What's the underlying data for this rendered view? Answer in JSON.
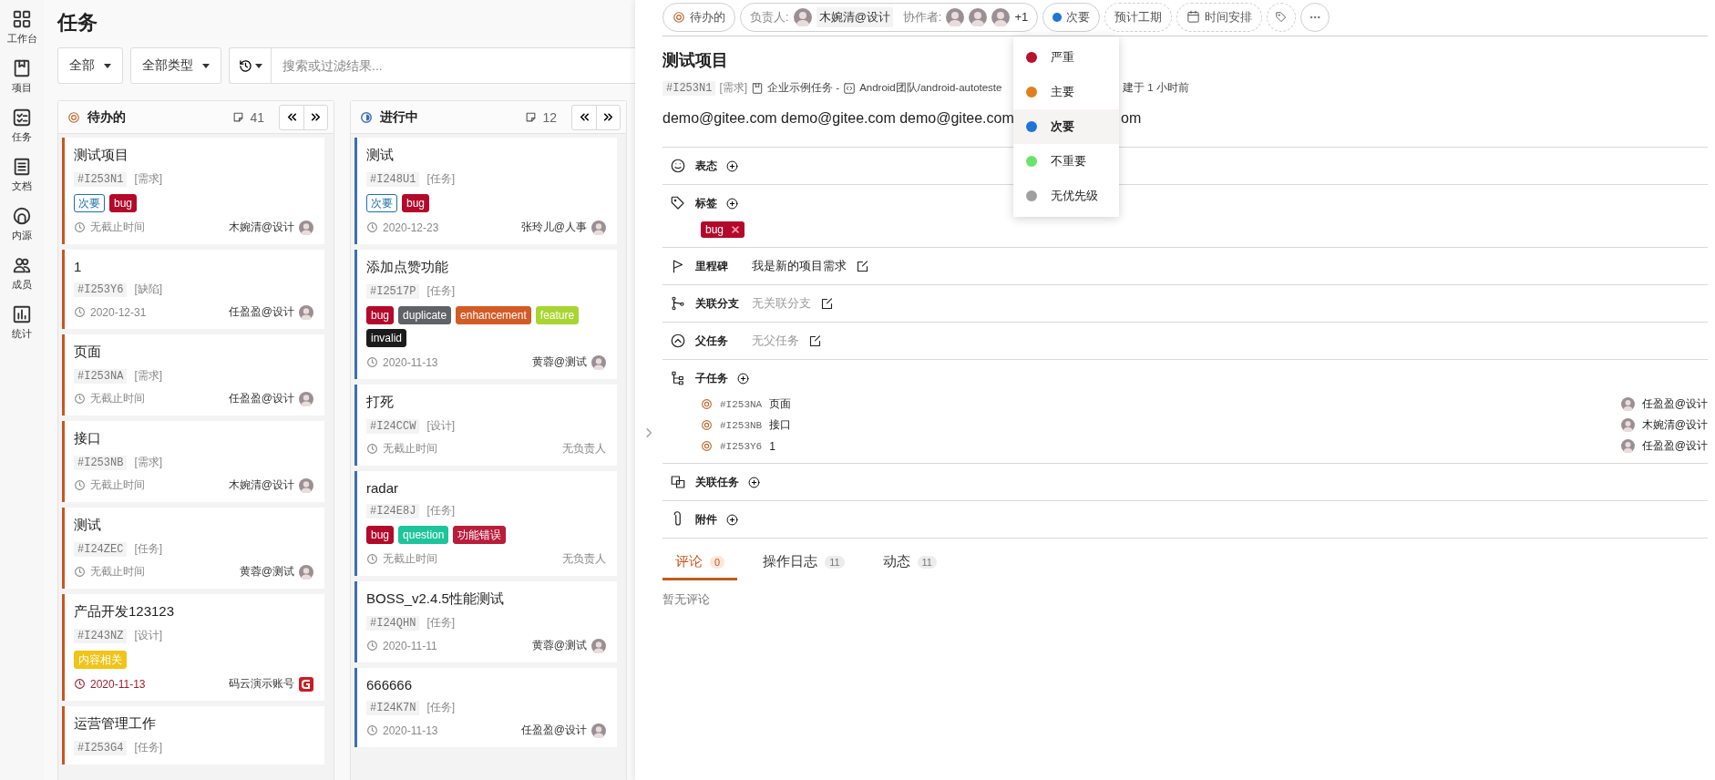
{
  "sidebar": {
    "items": [
      {
        "label": "工作台",
        "kind": "dashboard"
      },
      {
        "label": "项目",
        "kind": "project"
      },
      {
        "label": "任务",
        "kind": "task"
      },
      {
        "label": "文档",
        "kind": "doc"
      },
      {
        "label": "内源",
        "kind": "source"
      },
      {
        "label": "成员",
        "kind": "members"
      },
      {
        "label": "统计",
        "kind": "stats"
      }
    ]
  },
  "kanban": {
    "title": "任务",
    "filters": [
      {
        "label": "全部"
      },
      {
        "label": "全部类型"
      }
    ],
    "search": {
      "placeholder": "搜索或过滤结果..."
    },
    "columns": [
      {
        "name": "待办的",
        "kind": "todo",
        "color": "#c4591d",
        "count": "41",
        "cards": [
          {
            "title": "测试项目",
            "id": "#I253N1",
            "type": "[需求]",
            "tags": [
              {
                "text": "次要",
                "color": "#1f6fa8",
                "kind": "outline"
              },
              {
                "text": "bug",
                "color": "#b3092b",
                "kind": "solid"
              }
            ],
            "due": "无截止时间",
            "overdue": false,
            "assignee": {
              "name": "木婉清@设计",
              "kind": "photo"
            }
          },
          {
            "title": "1",
            "id": "#I253Y6",
            "type": "[缺陷]",
            "due": "2020-12-31",
            "overdue": false,
            "assignee": {
              "name": "任盈盈@设计",
              "kind": "photo"
            }
          },
          {
            "title": "页面",
            "id": "#I253NA",
            "type": "[需求]",
            "due": "无截止时间",
            "overdue": false,
            "assignee": {
              "name": "任盈盈@设计",
              "kind": "photo"
            }
          },
          {
            "title": "接口",
            "id": "#I253NB",
            "type": "[需求]",
            "due": "无截止时间",
            "overdue": false,
            "assignee": {
              "name": "木婉清@设计",
              "kind": "photo"
            }
          },
          {
            "title": "测试",
            "id": "#I24ZEC",
            "type": "[任务]",
            "due": "无截止时间",
            "overdue": false,
            "assignee": {
              "name": "黄蓉@测试",
              "kind": "photo"
            }
          },
          {
            "title": "产品开发123123",
            "id": "#I243NZ",
            "type": "[设计]",
            "tags": [
              {
                "text": "内容相关",
                "color": "#f0c419",
                "kind": "solid"
              }
            ],
            "due": "2020-11-13",
            "overdue": true,
            "assignee": {
              "name": "码云演示账号",
              "kind": "logo"
            }
          },
          {
            "title": "运营管理工作",
            "id": "#I253G4",
            "type": "[任务]"
          }
        ]
      },
      {
        "name": "进行中",
        "kind": "doing",
        "color": "#3a6fb5",
        "count": "12",
        "cards": [
          {
            "title": "测试",
            "id": "#I248U1",
            "type": "[任务]",
            "tags": [
              {
                "text": "次要",
                "color": "#1f6fa8",
                "kind": "outline"
              },
              {
                "text": "bug",
                "color": "#b3092b",
                "kind": "solid"
              }
            ],
            "due": "2020-12-23",
            "overdue": false,
            "assignee": {
              "name": "张玲儿@人事",
              "kind": "photo"
            }
          },
          {
            "title": "添加点赞功能",
            "id": "#I2517P",
            "type": "[任务]",
            "tags": [
              {
                "text": "bug",
                "color": "#b3092b",
                "kind": "solid"
              },
              {
                "text": "duplicate",
                "color": "#5f6368",
                "kind": "solid"
              },
              {
                "text": "enhancement",
                "color": "#d35b26",
                "kind": "solid"
              },
              {
                "text": "feature",
                "color": "#a8d532",
                "kind": "solid"
              },
              {
                "text": "invalid",
                "color": "#1b1b1b",
                "kind": "solid"
              }
            ],
            "due": "2020-11-13",
            "overdue": false,
            "assignee": {
              "name": "黄蓉@测试",
              "kind": "photo"
            }
          },
          {
            "title": "打死",
            "id": "#I24CCW",
            "type": "[设计]",
            "due": "无截止时间",
            "overdue": false,
            "assignee": {
              "name": "无负责人",
              "kind": "none"
            }
          },
          {
            "title": "radar",
            "id": "#I24E8J",
            "type": "[任务]",
            "tags": [
              {
                "text": "bug",
                "color": "#b3092b",
                "kind": "solid"
              },
              {
                "text": "question",
                "color": "#1fc49c",
                "kind": "solid"
              },
              {
                "text": "功能错误",
                "color": "#b81d3c",
                "kind": "solid"
              }
            ],
            "due": "无截止时间",
            "overdue": false,
            "assignee": {
              "name": "无负责人",
              "kind": "none"
            }
          },
          {
            "title": "BOSS_v2.4.5性能测试",
            "id": "#I24QHN",
            "type": "[任务]",
            "due": "2020-11-11",
            "overdue": false,
            "assignee": {
              "name": "黄蓉@测试",
              "kind": "photo"
            }
          },
          {
            "title": "666666",
            "id": "#I24K7N",
            "type": "[任务]",
            "due": "2020-11-13",
            "overdue": false,
            "assignee": {
              "name": "任盈盈@设计",
              "kind": "photo"
            }
          }
        ]
      }
    ]
  },
  "detail": {
    "status": {
      "label": "待办的"
    },
    "owner_label": "负责人:",
    "owner": "木婉清@设计",
    "collab_label": "协作者:",
    "collaborators": [
      {
        "kind": "photo"
      },
      {
        "kind": "photo"
      },
      {
        "kind": "photo"
      }
    ],
    "collab_more": "+1",
    "priority": {
      "label": "次要",
      "color": "#1f74d6"
    },
    "estimate": "预计工期",
    "schedule": "时间安排",
    "title": "测试项目",
    "meta": {
      "id": "#I253N1",
      "type": "[需求]",
      "project": "企业示例任务 -",
      "repo": "Android团队/android-autoteste",
      "created": "建于 1 小时前"
    },
    "description": [
      "demo@gitee.com demo@gitee.com demo@gitee.com",
      "om"
    ],
    "sections": [
      {
        "kind": "reactions",
        "label": "表态",
        "addable": true
      },
      {
        "kind": "labels",
        "label": "标签",
        "addable": true,
        "tags": [
          {
            "text": "bug",
            "color": "#b3092b"
          }
        ]
      },
      {
        "kind": "milestone",
        "label": "里程碑",
        "addable": false,
        "value": "我是新的项目需求",
        "muted": false
      },
      {
        "kind": "branch",
        "label": "关联分支",
        "addable": false,
        "value": "无关联分支",
        "muted": true
      },
      {
        "kind": "parent",
        "label": "父任务",
        "addable": false,
        "value": "无父任务",
        "muted": true
      },
      {
        "kind": "subtasks",
        "label": "子任务",
        "addable": true,
        "items": [
          {
            "id": "#I253NA",
            "title": "页面",
            "assignee": "任盈盈@设计"
          },
          {
            "id": "#I253NB",
            "title": "接口",
            "assignee": "木婉清@设计"
          },
          {
            "id": "#I253Y6",
            "title": "1",
            "assignee": "任盈盈@设计"
          }
        ]
      },
      {
        "kind": "linked",
        "label": "关联任务",
        "addable": true
      },
      {
        "kind": "attachments",
        "label": "附件",
        "addable": true
      }
    ],
    "tabs": [
      {
        "label": "评论",
        "count": "0",
        "selected": true
      },
      {
        "label": "操作日志",
        "count": "11",
        "selected": false
      },
      {
        "label": "动态",
        "count": "11",
        "selected": false
      }
    ],
    "empty_comment": "暂无评论"
  },
  "priority_menu": {
    "options": [
      {
        "label": "严重",
        "color": "#b7122e",
        "selected": false
      },
      {
        "label": "主要",
        "color": "#e07f1f",
        "selected": false
      },
      {
        "label": "次要",
        "color": "#1f74d6",
        "selected": true
      },
      {
        "label": "不重要",
        "color": "#6ce26a",
        "selected": false
      },
      {
        "label": "无优先级",
        "color": "#a0a0a0",
        "selected": false
      }
    ]
  }
}
